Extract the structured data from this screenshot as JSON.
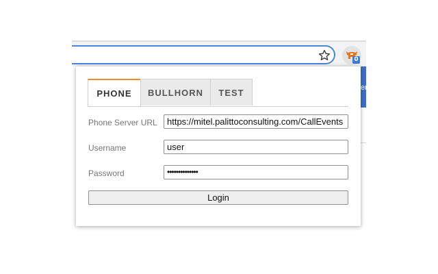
{
  "browser": {
    "extension_badge": "0",
    "page_fragment_text": "er"
  },
  "popup": {
    "tabs": [
      {
        "label": "PHONE",
        "active": true
      },
      {
        "label": "BULLHORN",
        "active": false
      },
      {
        "label": "TEST",
        "active": false
      }
    ],
    "fields": {
      "server_url": {
        "label": "Phone Server URL",
        "value": "https://mitel.palittoconsulting.com/CallEvents"
      },
      "username": {
        "label": "Username",
        "value": "user"
      },
      "password": {
        "label": "Password",
        "value": "••••••••••••••"
      }
    },
    "login_label": "Login"
  },
  "colors": {
    "accent_tab": "#ee8c2c",
    "omnibox_focus": "#4a85d9",
    "badge": "#3b7ad8"
  },
  "icons": [
    "star-icon",
    "extension-logo-icon"
  ]
}
